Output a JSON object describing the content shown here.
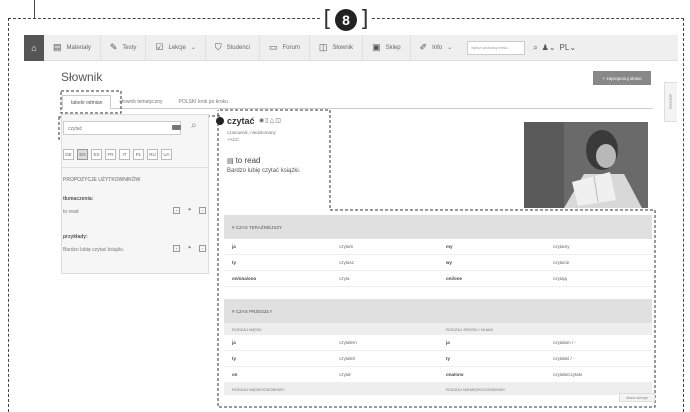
{
  "callout": {
    "left_bracket": "[",
    "number": "8",
    "right_bracket": "]"
  },
  "nav": {
    "home_icon": "home-icon",
    "items": [
      {
        "label": "Materiały",
        "icon": "book-icon"
      },
      {
        "label": "Testy",
        "icon": "pencil-icon"
      },
      {
        "label": "Lekcje",
        "icon": "edit-icon",
        "has_dropdown": true
      },
      {
        "label": "Studenci",
        "icon": "graduation-cap-icon"
      },
      {
        "label": "Forum",
        "icon": "chat-icon"
      },
      {
        "label": "Słownik",
        "icon": "dictionary-icon"
      },
      {
        "label": "Sklep",
        "icon": "shop-icon"
      },
      {
        "label": "Info",
        "icon": "pen-icon",
        "has_dropdown": true
      }
    ],
    "search_placeholder": "wpisz szukaną treść...",
    "user_icon": "user-icon",
    "language": "PL"
  },
  "page_title": "Słownik",
  "propose_button": "+ zaproponuj słowo",
  "favorites_tab": "ulubione",
  "tabs": [
    "tabele odmian",
    "słownik tematyczny",
    "POLSKI krok po kroku"
  ],
  "search": {
    "value": "czytać"
  },
  "languages": [
    {
      "code": "DE",
      "selected": false
    },
    {
      "code": "EN",
      "selected": true
    },
    {
      "code": "ES",
      "selected": false
    },
    {
      "code": "FR",
      "selected": false
    },
    {
      "code": "IT",
      "selected": false
    },
    {
      "code": "PL",
      "selected": false
    },
    {
      "code": "RU",
      "selected": false
    },
    {
      "code": "UA",
      "selected": false
    }
  ],
  "user_proposals": {
    "heading": "PROPOZYCJE UŻYTKOWNIKÓW",
    "translations_label": "tłumaczenia:",
    "translation": "to read",
    "examples_label": "przykłady:",
    "example": "Bardzo lubię czytać książki."
  },
  "entry": {
    "word": "czytać",
    "grammar": "czasownik, niedokonany",
    "case": "+ACC",
    "translation": "to read",
    "example": "Bardzo lubię czytać książki."
  },
  "present": {
    "header": "# CZAS TERAŹNIEJSZY",
    "rows": [
      [
        "ja",
        "czytam",
        "my",
        "czytamy"
      ],
      [
        "ty",
        "czytasz",
        "wy",
        "czytacie"
      ],
      [
        "on/ona/ono",
        "czyta",
        "oni/one",
        "czytają"
      ]
    ]
  },
  "past": {
    "header": "# CZAS PRZESZŁY",
    "sub1": [
      "RODZAJ MĘSKI",
      "RODZAJ ŻEŃSKI / NIJAKI"
    ],
    "rows": [
      [
        "ja",
        "czytałem",
        "ja",
        "czytałam / -"
      ],
      [
        "ty",
        "czytałeś",
        "ty",
        "czytałaś / -"
      ],
      [
        "on",
        "czytał",
        "ona/ono",
        "czytała/czytało"
      ]
    ],
    "sub2": [
      "RODZAJ MĘSKOOSOBOWY",
      "RODZAJ NIEMĘSKOOSOBOWY"
    ]
  },
  "old_version": "stara wersja"
}
